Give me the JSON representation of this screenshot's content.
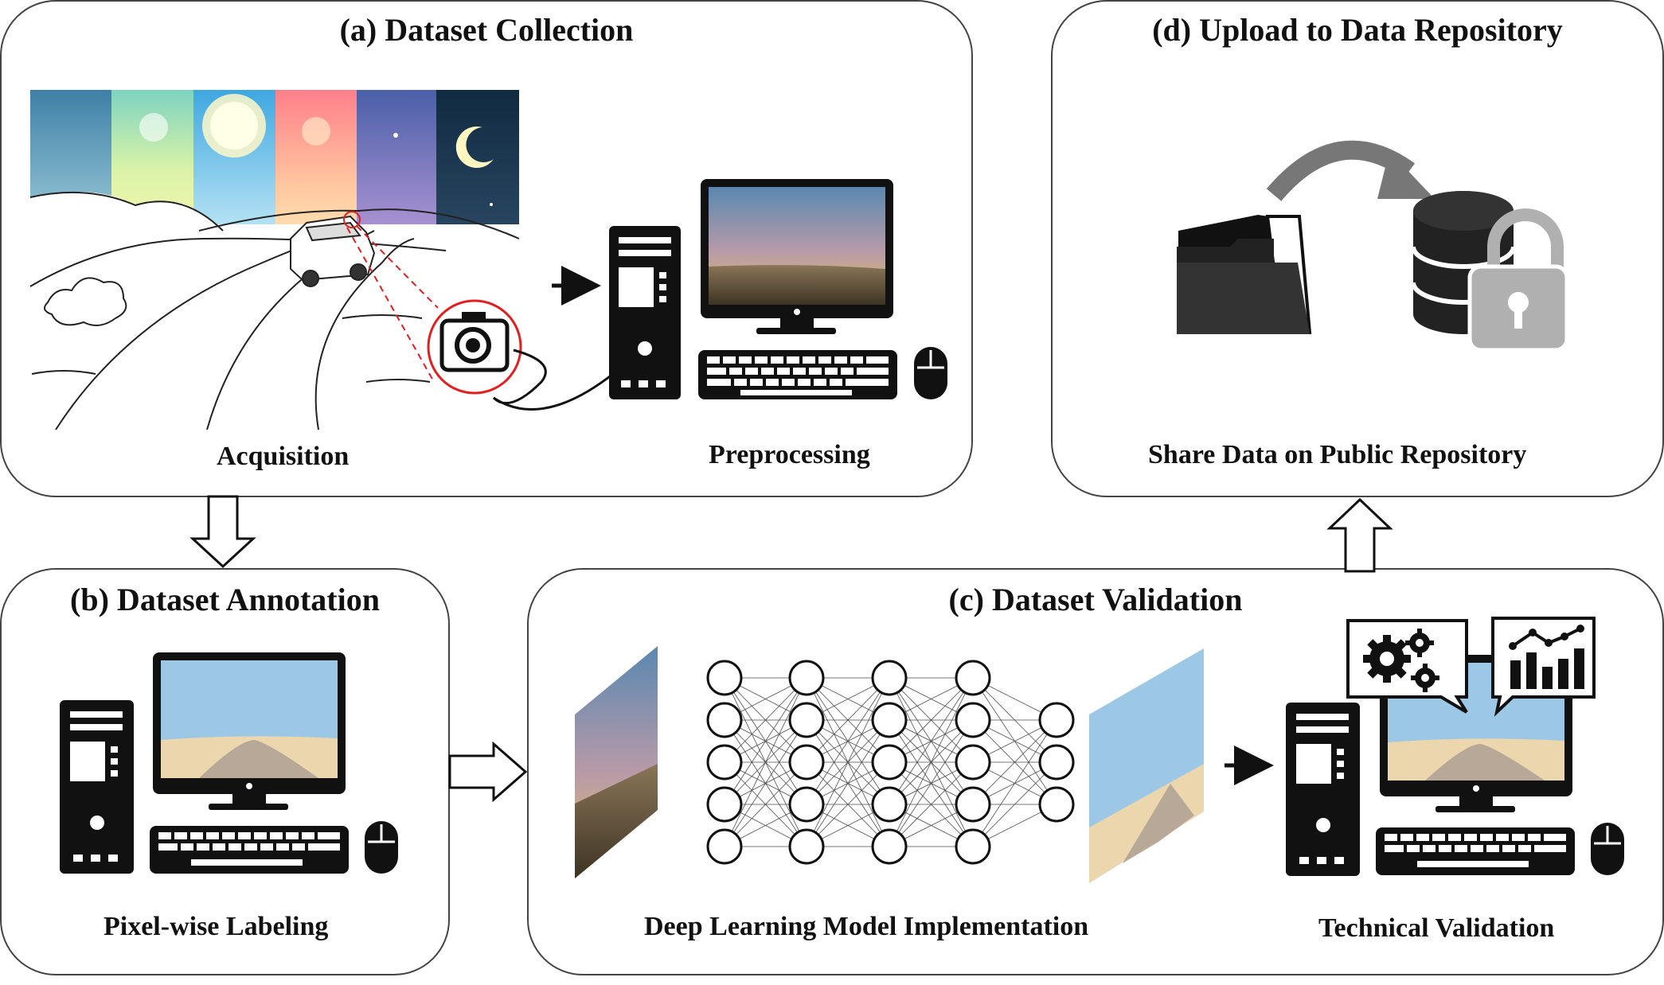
{
  "panels": {
    "collection": {
      "title": "(a) Dataset Collection",
      "acquisition_label": "Acquisition",
      "preprocessing_label": "Preprocessing"
    },
    "repository": {
      "title": "(d) Upload to Data Repository",
      "share_label": "Share Data on Public Repository"
    },
    "annotation": {
      "title": "(b) Dataset Annotation",
      "labeling_label": "Pixel-wise Labeling"
    },
    "validation": {
      "title": "(c) Dataset Validation",
      "model_label": "Deep Learning Model Implementation",
      "technical_label": "Technical Validation"
    }
  },
  "colors": {
    "border": "#444444",
    "icon": "#111111",
    "sky_label": "#9cc8e6",
    "sand_label": "#ecd6ae",
    "road_label": "#b8a898",
    "camera_circle": "#e02020",
    "arrow_grey": "#777777",
    "lock_grey": "#b0b0b0"
  }
}
